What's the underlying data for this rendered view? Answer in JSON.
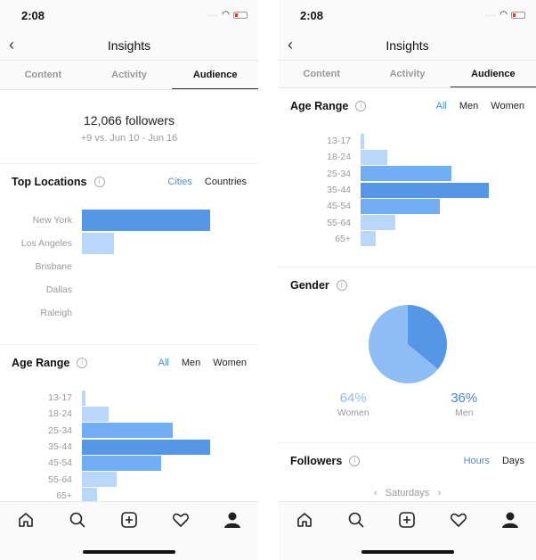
{
  "status": {
    "time": "2:08"
  },
  "nav": {
    "title": "Insights",
    "back": "‹"
  },
  "tabs": [
    "Content",
    "Activity",
    "Audience"
  ],
  "followers": {
    "count": "12,066 followers",
    "delta": "+9 vs. Jun 10 - Jun 16"
  },
  "locations": {
    "title": "Top Locations",
    "filters": [
      "Cities",
      "Countries"
    ],
    "active": "Cities"
  },
  "age": {
    "title": "Age Range",
    "filters": [
      "All",
      "Men",
      "Women"
    ],
    "active": "All"
  },
  "gender": {
    "title": "Gender",
    "women_pct": "64%",
    "women_label": "Women",
    "men_pct": "36%",
    "men_label": "Men"
  },
  "followers_sec": {
    "title": "Followers",
    "filters": [
      "Hours",
      "Days"
    ],
    "active": "Hours",
    "day_label": "Saturdays",
    "prev": "‹",
    "next": "›"
  },
  "colors": {
    "accent": "#4a90d9",
    "bar_dark": "#5596e6",
    "bar_mid": "#72aef3",
    "bar_light": "#b9d7fb"
  },
  "chart_data": [
    {
      "type": "bar",
      "title": "Top Locations",
      "categories": [
        "New York",
        "Los Angeles",
        "Brisbane",
        "Dallas",
        "Raleigh"
      ],
      "values": [
        100,
        25,
        0,
        0,
        0
      ],
      "unit": "relative %"
    },
    {
      "type": "bar",
      "title": "Age Range",
      "categories": [
        "13-17",
        "18-24",
        "25-34",
        "35-44",
        "45-54",
        "55-64",
        "65+"
      ],
      "values": [
        3,
        21,
        71,
        100,
        62,
        27,
        12
      ],
      "unit": "relative %"
    },
    {
      "type": "pie",
      "title": "Gender",
      "categories": [
        "Women",
        "Men"
      ],
      "values": [
        64,
        36
      ]
    }
  ]
}
